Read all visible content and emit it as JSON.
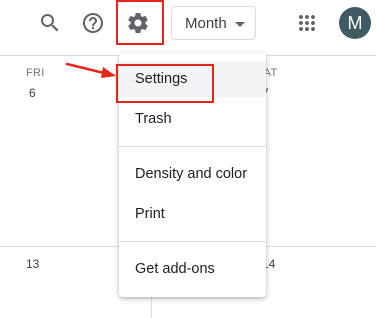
{
  "toolbar": {
    "view_select": "Month",
    "avatar_letter": "M"
  },
  "grid": {
    "days": [
      {
        "label": "FRI",
        "number": "6"
      },
      {
        "label": "SAT",
        "number": "7"
      }
    ],
    "next_week": [
      "13",
      "14"
    ]
  },
  "menu": {
    "items": [
      {
        "label": "Settings"
      },
      {
        "label": "Trash"
      },
      {
        "label": "Density and color"
      },
      {
        "label": "Print"
      },
      {
        "label": "Get add-ons"
      }
    ]
  },
  "annotation": {
    "highlight_color": "#e8251a",
    "arrow_color": "#e8251a"
  },
  "icons": [
    "search-icon",
    "help-icon",
    "gear-icon",
    "dropdown-caret-icon",
    "apps-grid-icon"
  ]
}
